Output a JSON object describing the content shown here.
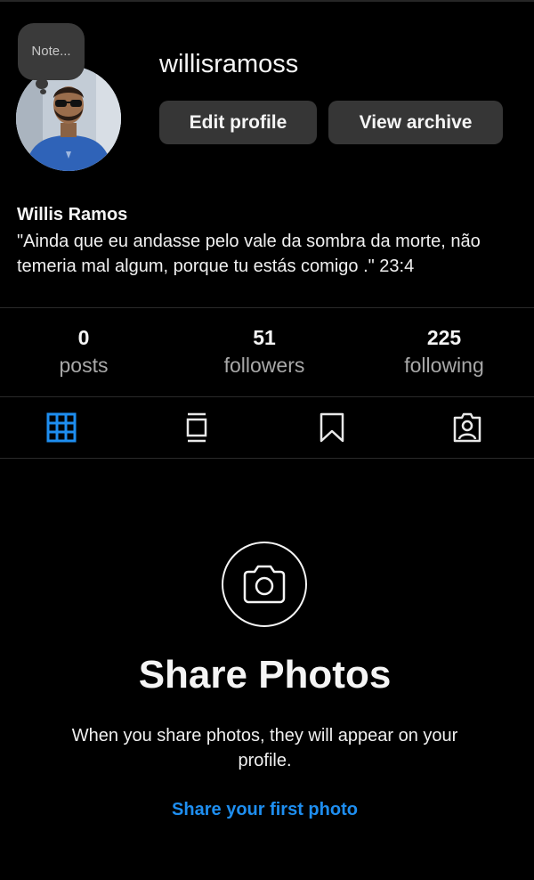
{
  "profile": {
    "note": "Note...",
    "username": "willisramoss",
    "edit_profile_label": "Edit profile",
    "view_archive_label": "View archive",
    "full_name": "Willis Ramos",
    "bio": "\"Ainda que eu andasse pelo vale da sombra da morte, não temeria mal algum, porque tu estás comigo .\" 23:4"
  },
  "stats": [
    {
      "count": "0",
      "label": "posts"
    },
    {
      "count": "51",
      "label": "followers"
    },
    {
      "count": "225",
      "label": "following"
    }
  ],
  "tabs": [
    {
      "icon": "grid-icon",
      "active": true
    },
    {
      "icon": "reels-feed-icon",
      "active": false
    },
    {
      "icon": "bookmark-icon",
      "active": false
    },
    {
      "icon": "tagged-person-icon",
      "active": false
    }
  ],
  "empty_state": {
    "icon": "camera-icon",
    "title": "Share Photos",
    "description": "When you share photos, they will appear on your profile.",
    "cta": "Share your first photo"
  },
  "colors": {
    "background": "#000000",
    "button": "#363636",
    "accent": "#1e8ef0",
    "muted_text": "#a8a8a8"
  }
}
